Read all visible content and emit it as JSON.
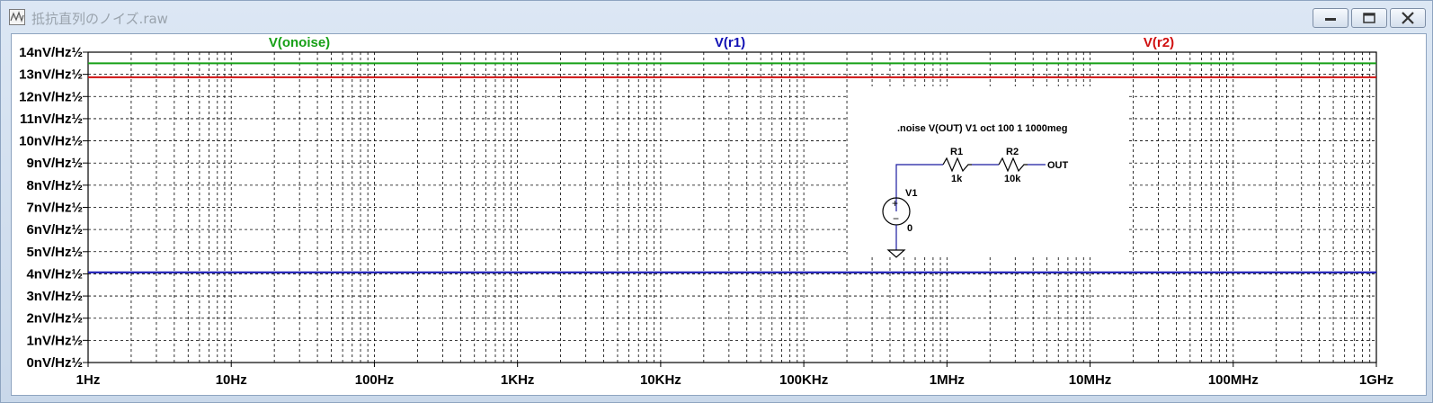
{
  "window": {
    "title": "抵抗直列のノイズ.raw",
    "app_icon": "waveform-viewer-icon"
  },
  "traces": [
    {
      "name": "V(onoise)",
      "color": "#16a016",
      "value": 13.5
    },
    {
      "name": "V(r1)",
      "color": "#1010b4",
      "value": 4.07
    },
    {
      "name": "V(r2)",
      "color": "#d01010",
      "value": 12.87
    }
  ],
  "chart_data": {
    "type": "line",
    "x_scale": "log",
    "xlim": [
      1,
      1000000000
    ],
    "ylim": [
      0,
      14
    ],
    "grid": true,
    "x_tick_labels": [
      "1Hz",
      "10Hz",
      "100Hz",
      "1KHz",
      "10KHz",
      "100KHz",
      "1MHz",
      "10MHz",
      "100MHz",
      "1GHz"
    ],
    "y_tick_labels": [
      "0nV/Hz½",
      "1nV/Hz½",
      "2nV/Hz½",
      "3nV/Hz½",
      "4nV/Hz½",
      "5nV/Hz½",
      "6nV/Hz½",
      "7nV/Hz½",
      "8nV/Hz½",
      "9nV/Hz½",
      "10nV/Hz½",
      "11nV/Hz½",
      "12nV/Hz½",
      "13nV/Hz½",
      "14nV/Hz½"
    ],
    "series": [
      {
        "name": "V(onoise)",
        "x": [
          1,
          1000000000
        ],
        "y": [
          13.5,
          13.5
        ]
      },
      {
        "name": "V(r1)",
        "x": [
          1,
          1000000000
        ],
        "y": [
          4.07,
          4.07
        ]
      },
      {
        "name": "V(r2)",
        "x": [
          1,
          1000000000
        ],
        "y": [
          12.87,
          12.87
        ]
      }
    ]
  },
  "schematic": {
    "directive": ".noise V(OUT) V1 oct 100 1 1000meg",
    "r1": {
      "name": "R1",
      "value": "1k"
    },
    "r2": {
      "name": "R2",
      "value": "10k"
    },
    "source": {
      "name": "V1",
      "value": "0"
    },
    "out_label": "OUT"
  }
}
